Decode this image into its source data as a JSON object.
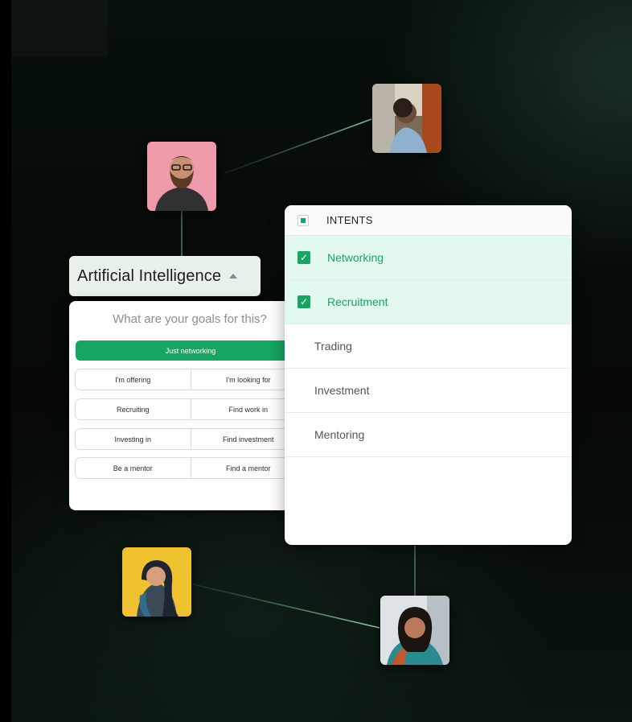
{
  "topic": {
    "label": "Artificial Intelligence"
  },
  "goals": {
    "question": "What are your goals for this?",
    "primary": "Just networking",
    "rows": [
      [
        "I'm offering",
        "I'm looking for"
      ],
      [
        "Recruiting",
        "Find work in"
      ],
      [
        "Investing in",
        "Find investment"
      ],
      [
        "Be a mentor",
        "Find a mentor"
      ]
    ]
  },
  "intents": {
    "title": "INTENTS",
    "items": [
      {
        "label": "Networking",
        "selected": true
      },
      {
        "label": "Recruitment",
        "selected": true
      },
      {
        "label": "Trading",
        "selected": false
      },
      {
        "label": "Investment",
        "selected": false
      },
      {
        "label": "Mentoring",
        "selected": false
      }
    ]
  },
  "colors": {
    "accent": "#16a562",
    "selected_row": "#e3f8ee",
    "chip_bg": "#e8f1ea"
  },
  "icons": {
    "checkbox": "check-icon",
    "caret": "caret-up-icon"
  }
}
